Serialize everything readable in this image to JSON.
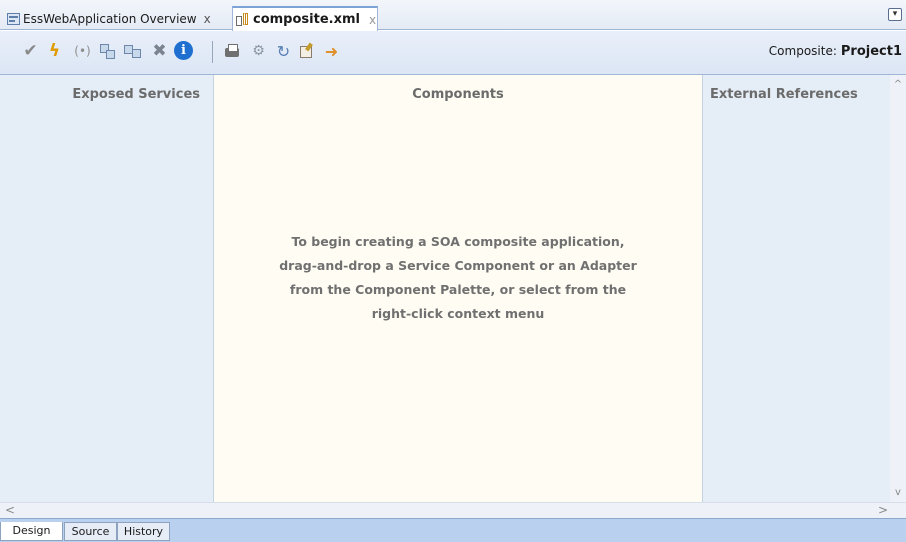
{
  "tabs": [
    {
      "label": "EssWebApplication Overview",
      "close": "x",
      "icon": "overview-icon",
      "active": false
    },
    {
      "label": "composite.xml",
      "close": "x",
      "icon": "composite-icon",
      "active": true
    }
  ],
  "tab_menu_glyph": "▾",
  "toolbar": {
    "icons": [
      "validate-check-icon",
      "test-lightning-icon",
      "wire-icon",
      "group-icon",
      "ungroup-icon",
      "delete-icon",
      "info-icon",
      "print-icon",
      "layout-icon",
      "refresh-icon",
      "edit-icon",
      "deploy-icon"
    ],
    "composite_label": "Composite:",
    "composite_name": "Project1"
  },
  "lanes": {
    "left_title": "Exposed Services",
    "mid_title": "Components",
    "right_title": "External References"
  },
  "hint": {
    "line1": "To begin creating a SOA composite application,",
    "line2": "drag-and-drop a Service Component or an Adapter",
    "line3": "from the Component Palette, or select from the",
    "line4": "right-click context menu"
  },
  "bottom_tabs": [
    {
      "label": "Design",
      "active": true
    },
    {
      "label": "Source",
      "active": false
    },
    {
      "label": "History",
      "active": false
    }
  ],
  "colors": {
    "lane_side_bg": "#e5eef7",
    "lane_mid_bg": "#fffdf3",
    "bottom_bar": "#b9d1ee"
  }
}
